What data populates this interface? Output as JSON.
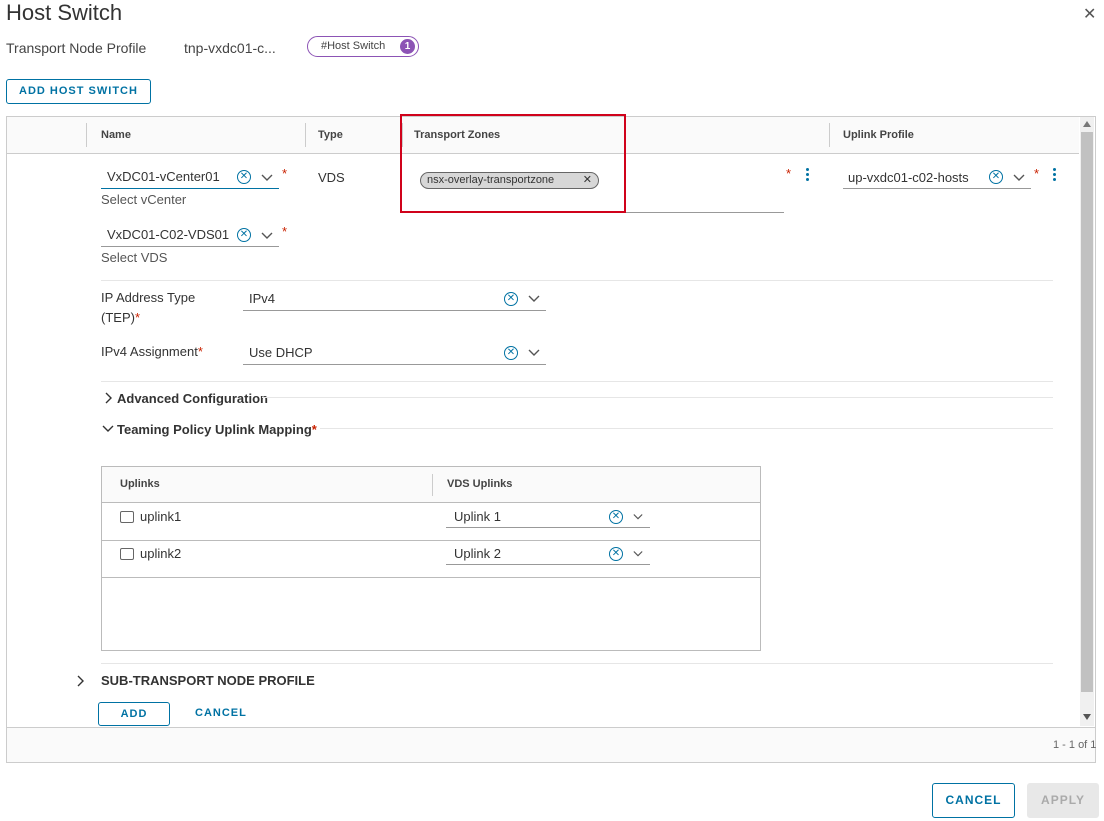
{
  "dialog": {
    "title": "Host Switch",
    "close_icon": "close-icon"
  },
  "breadcrumb": {
    "label": "Transport Node Profile",
    "value": "tnp-vxdc01-c...",
    "tag_label": "#Host Switch",
    "tag_count": "1"
  },
  "toolbar": {
    "add_host_switch_label": "ADD HOST SWITCH"
  },
  "grid": {
    "columns": [
      "Name",
      "Type",
      "Transport Zones",
      "Uplink Profile"
    ],
    "row": {
      "vcenter_value": "VxDC01-vCenter01",
      "vcenter_help": "Select vCenter",
      "type_value": "VDS",
      "vds_value": "VxDC01-C02-VDS01",
      "vds_help": "Select VDS",
      "transport_zone_chip": "nsx-overlay-transportzone",
      "uplink_profile_value": "up-vxdc01-c02-hosts",
      "ip_address_type_label": "IP Address Type",
      "ip_address_type_label2": "(TEP)",
      "ip_address_type_value": "IPv4",
      "ipv4_assignment_label": "IPv4 Assignment",
      "ipv4_assignment_value": "Use DHCP",
      "advanced_configuration_label": "Advanced Configuration",
      "teaming_policy_label": "Teaming Policy Uplink Mapping",
      "sub_transport_node_profile_label": "SUB-TRANSPORT NODE PROFILE",
      "add_label": "ADD",
      "cancel_label": "CANCEL"
    },
    "uplink_mapping": {
      "columns": [
        "Uplinks",
        "VDS Uplinks"
      ],
      "rows": [
        {
          "uplink": "uplink1",
          "vds_uplink": "Uplink 1"
        },
        {
          "uplink": "uplink2",
          "vds_uplink": "Uplink 2"
        }
      ]
    },
    "footer_pagination": "1 - 1 of 1"
  },
  "footer": {
    "cancel_label": "CANCEL",
    "apply_label": "APPLY"
  },
  "colors": {
    "accent": "#0072a3",
    "required": "#c92100",
    "highlight_box": "#d0021b",
    "tag_purple": "#8c53b5"
  }
}
